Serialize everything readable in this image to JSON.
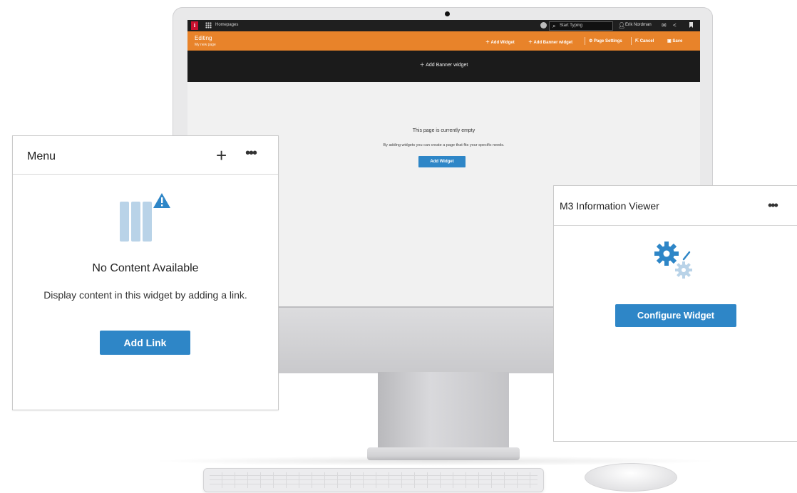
{
  "app": {
    "topbar": {
      "logo_letter": "i",
      "breadcrumb": "Homepages",
      "search_placeholder": "Start Typing",
      "user_name": "Erik Nordman"
    },
    "editbar": {
      "title": "Editing",
      "subtitle": "My new page",
      "actions": [
        {
          "label": "Add Widget",
          "icon": "plus-icon"
        },
        {
          "label": "Add Banner widget",
          "icon": "plus-icon"
        },
        {
          "label": "Page Settings",
          "icon": "gear-icon"
        },
        {
          "label": "Cancel",
          "icon": "exit-icon"
        },
        {
          "label": "Save",
          "icon": "save-icon"
        }
      ]
    },
    "banner": {
      "add_label": "Add Banner widget"
    },
    "empty_state": {
      "title": "This page is currently empty",
      "description": "By adding widgets you can create a page that fits your specific needs.",
      "button_label": "Add Widget"
    }
  },
  "menu_widget": {
    "title": "Menu",
    "heading": "No Content Available",
    "description": "Display content in this widget by adding a link.",
    "button_label": "Add Link"
  },
  "m3_widget": {
    "title": "M3 Information Viewer",
    "button_label": "Configure Widget"
  },
  "colors": {
    "accent": "#e8832a",
    "primary_button": "#2e86c7",
    "brand_logo": "#c8102e",
    "topbar": "#1f1f1f",
    "illustration_light": "#b9d3e8"
  }
}
